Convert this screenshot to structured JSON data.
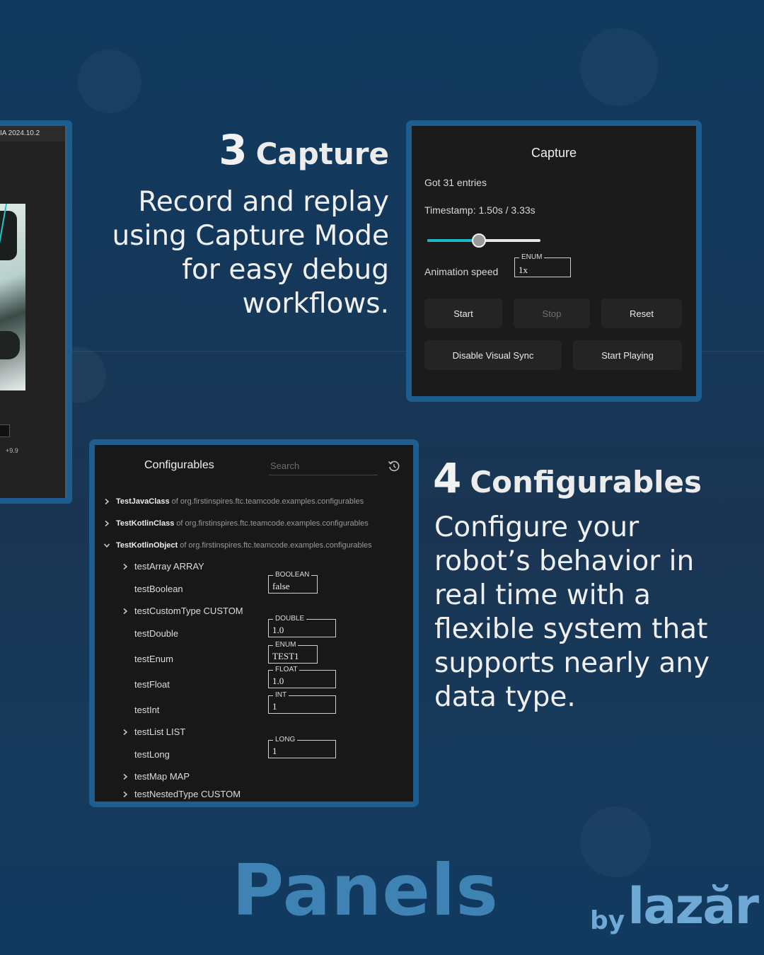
{
  "left_panel": {
    "title": "IA 2024.10.2",
    "stat": "+9.9"
  },
  "section3": {
    "number": "3",
    "title": "Capture",
    "body_lines": [
      "Record and replay",
      "using Capture Mode",
      "for easy debug",
      "workflows."
    ]
  },
  "capture": {
    "title": "Capture",
    "entries_text": "Got 31 entries",
    "timestamp_text": "Timestamp: 1.50s / 3.33s",
    "slider_fraction": 0.45,
    "animation_label": "Animation speed",
    "speed_field": {
      "type": "ENUM",
      "value": "1x"
    },
    "buttons": {
      "start": "Start",
      "stop": "Stop",
      "reset": "Reset",
      "disable_visual_sync": "Disable Visual Sync",
      "start_playing": "Start Playing"
    },
    "accent_color": "#1fb5c4"
  },
  "configurables": {
    "title": "Configurables",
    "search_placeholder": "Search",
    "classes": [
      {
        "name": "TestJavaClass",
        "pkg": "of org.firstinspires.ftc.teamcode.examples.configurables",
        "expanded": false
      },
      {
        "name": "TestKotlinClass",
        "pkg": "of org.firstinspires.ftc.teamcode.examples.configurables",
        "expanded": false
      },
      {
        "name": "TestKotlinObject",
        "pkg": "of org.firstinspires.ftc.teamcode.examples.configurables",
        "expanded": true
      }
    ],
    "fields": [
      {
        "name": "testArray ARRAY",
        "expandable": true
      },
      {
        "name": "testBoolean",
        "type": "BOOLEAN",
        "value": "false"
      },
      {
        "name": "testCustomType CUSTOM",
        "expandable": true
      },
      {
        "name": "testDouble",
        "type": "DOUBLE",
        "value": "1.0"
      },
      {
        "name": "testEnum",
        "type": "ENUM",
        "value": "TEST1"
      },
      {
        "name": "testFloat",
        "type": "FLOAT",
        "value": "1.0"
      },
      {
        "name": "testInt",
        "type": "INT",
        "value": "1"
      },
      {
        "name": "testList LIST",
        "expandable": true
      },
      {
        "name": "testLong",
        "type": "LONG",
        "value": "1"
      },
      {
        "name": "testMap MAP",
        "expandable": true
      },
      {
        "name": "testNestedType CUSTOM",
        "expandable": true
      }
    ]
  },
  "section4": {
    "number": "4",
    "title": "Configurables",
    "body_lines": [
      "Configure your",
      "robot’s behavior in",
      "real time with a",
      "flexible system that",
      "supports nearly any",
      "data type."
    ]
  },
  "branding": {
    "product": "Panels",
    "by": "by",
    "logo": "lazăr"
  },
  "colors": {
    "frame_border": "#1d5d8f",
    "background": "#15385a",
    "brand": "#6fa9d6",
    "panels_word": "#3f83b5"
  }
}
